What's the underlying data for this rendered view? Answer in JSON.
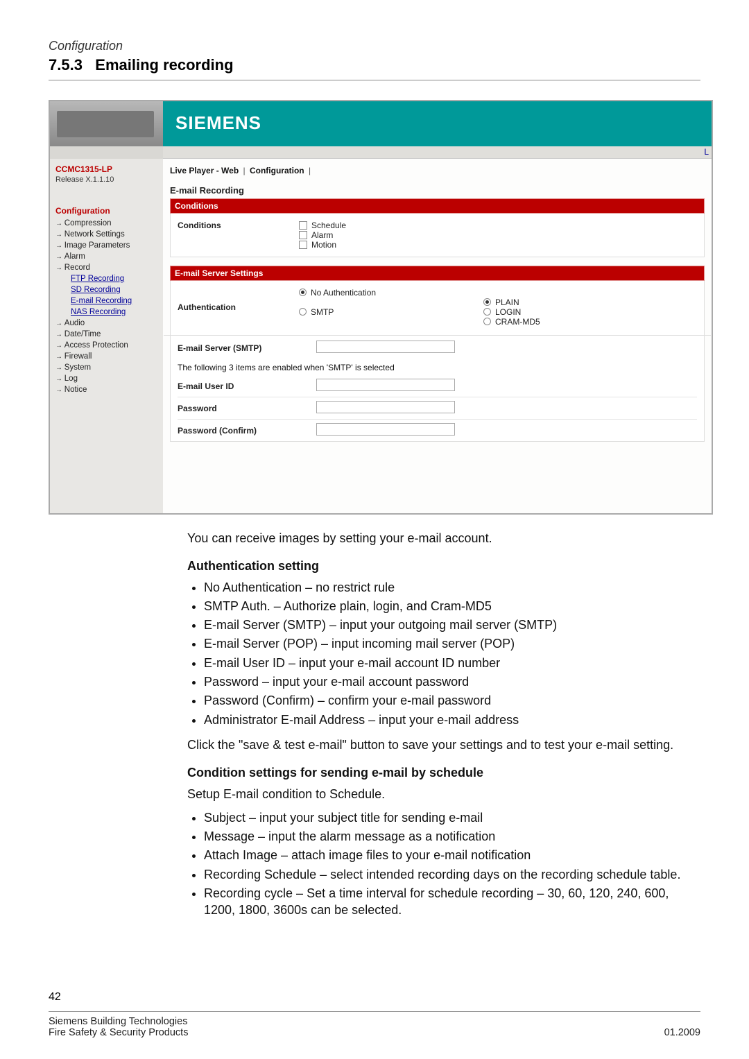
{
  "header": {
    "config_label": "Configuration",
    "section_number": "7.5.3",
    "section_title": "Emailing recording"
  },
  "screenshot": {
    "brand": "SIEMENS",
    "top_right_letter": "L",
    "device_model": "CCMC1315-LP",
    "release": "Release X.1.1.10",
    "sidebar": {
      "section": "Configuration",
      "items": [
        {
          "label": "Compression",
          "type": "arrow"
        },
        {
          "label": "Network Settings",
          "type": "arrow"
        },
        {
          "label": "Image Parameters",
          "type": "arrow"
        },
        {
          "label": "Alarm",
          "type": "arrow"
        },
        {
          "label": "Record",
          "type": "arrow"
        },
        {
          "label": "FTP Recording",
          "type": "sub"
        },
        {
          "label": "SD Recording",
          "type": "sub"
        },
        {
          "label": "E-mail Recording",
          "type": "sub"
        },
        {
          "label": "NAS Recording",
          "type": "sub"
        },
        {
          "label": "Audio",
          "type": "arrow"
        },
        {
          "label": "Date/Time",
          "type": "arrow"
        },
        {
          "label": "Access Protection",
          "type": "arrow"
        },
        {
          "label": "Firewall",
          "type": "arrow"
        },
        {
          "label": "System",
          "type": "arrow"
        },
        {
          "label": "Log",
          "type": "arrow"
        },
        {
          "label": "Notice",
          "type": "arrow"
        }
      ]
    },
    "breadcrumb": {
      "a": "Live Player - Web",
      "b": "Configuration"
    },
    "page_title": "E-mail Recording",
    "conditions": {
      "panel": "Conditions",
      "label": "Conditions",
      "opts": [
        "Schedule",
        "Alarm",
        "Motion"
      ]
    },
    "server": {
      "panel": "E-mail Server Settings",
      "auth_label": "Authentication",
      "no_auth": "No Authentication",
      "smtp": "SMTP",
      "plain": "PLAIN",
      "login": "LOGIN",
      "cram": "CRAM-MD5",
      "smtp_server": "E-mail Server (SMTP)",
      "note": "The following 3 items are enabled when 'SMTP' is selected",
      "user": "E-mail User ID",
      "pw": "Password",
      "pwc": "Password (Confirm)"
    }
  },
  "body": {
    "intro": "You can receive images by setting your e-mail account.",
    "auth_head": "Authentication setting",
    "auth_items": [
      "No Authentication – no restrict rule",
      "SMTP Auth. – Authorize plain, login, and Cram-MD5",
      "E-mail Server (SMTP) – input your outgoing mail server (SMTP)",
      "E-mail Server (POP) – input incoming mail server (POP)",
      "E-mail User ID – input your e-mail account ID number",
      "Password – input your e-mail account password",
      "Password (Confirm) – confirm your e-mail password",
      "Administrator E-mail Address – input your e-mail address"
    ],
    "click_note": "Click the \"save & test e-mail\" button to save your settings and to test your e-mail setting.",
    "cond_head": "Condition settings for sending e-mail by schedule",
    "cond_intro": "Setup E-mail condition to Schedule.",
    "cond_items": [
      "Subject – input your subject title for sending e-mail",
      "Message – input the alarm message as a notification",
      "Attach Image – attach image files to your e-mail notification",
      "Recording Schedule – select intended recording days on the recording schedule table.",
      "Recording cycle – Set a time interval for schedule recording – 30, 60, 120, 240, 600, 1200, 1800, 3600s can be selected."
    ]
  },
  "footer": {
    "page": "42",
    "l1": "Siemens Building Technologies",
    "l2": "Fire Safety & Security Products",
    "date": "01.2009"
  }
}
